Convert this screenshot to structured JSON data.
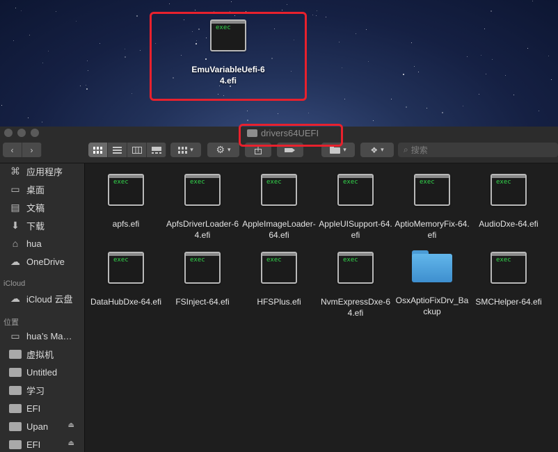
{
  "desktop": {
    "file": {
      "icon": "exec-file-icon",
      "icon_text": "exec",
      "label_line1": "EmuVariableUefi-6",
      "label_line2": "4.efi"
    }
  },
  "window": {
    "title": "drivers64UEFI",
    "toolbar": {
      "back": "‹",
      "forward": "›",
      "search_placeholder": "搜索"
    }
  },
  "sidebar": {
    "favorites": [
      {
        "label": "应用程序",
        "icon": "applications-icon"
      },
      {
        "label": "桌面",
        "icon": "desktop-icon"
      },
      {
        "label": "文稿",
        "icon": "documents-icon"
      },
      {
        "label": "下载",
        "icon": "downloads-icon"
      },
      {
        "label": "hua",
        "icon": "home-icon"
      },
      {
        "label": "OneDrive",
        "icon": "cloud-icon"
      }
    ],
    "icloud_header": "iCloud",
    "icloud": [
      {
        "label": "iCloud 云盘",
        "icon": "icloud-icon"
      }
    ],
    "locations_header": "位置",
    "locations": [
      {
        "label": "hua’s Ma…",
        "icon": "laptop-icon"
      },
      {
        "label": "虚拟机",
        "icon": "folder-icon"
      },
      {
        "label": "Untitled",
        "icon": "folder-icon"
      },
      {
        "label": "学习",
        "icon": "folder-icon"
      },
      {
        "label": "EFI",
        "icon": "folder-icon"
      },
      {
        "label": "Upan",
        "icon": "folder-icon",
        "eject": "⏏"
      },
      {
        "label": "EFI",
        "icon": "folder-icon",
        "eject": "⏏"
      }
    ]
  },
  "files": [
    {
      "name": "apfs.efi",
      "kind": "exec",
      "icon_text": "exec"
    },
    {
      "name": "ApfsDriverLoader-64.efi",
      "kind": "exec",
      "icon_text": "exec"
    },
    {
      "name": "AppleImageLoader-64.efi",
      "kind": "exec",
      "icon_text": "exec"
    },
    {
      "name": "AppleUISupport-64.efi",
      "kind": "exec",
      "icon_text": "exec"
    },
    {
      "name": "AptioMemoryFix-64.efi",
      "kind": "exec",
      "icon_text": "exec"
    },
    {
      "name": "AudioDxe-64.efi",
      "kind": "exec",
      "icon_text": "exec"
    },
    {
      "name": "DataHubDxe-64.efi",
      "kind": "exec",
      "icon_text": "exec"
    },
    {
      "name": "FSInject-64.efi",
      "kind": "exec",
      "icon_text": "exec"
    },
    {
      "name": "HFSPlus.efi",
      "kind": "exec",
      "icon_text": "exec"
    },
    {
      "name": "NvmExpressDxe-64.efi",
      "kind": "exec",
      "icon_text": "exec"
    },
    {
      "name": "OsxAptioFixDrv_Backup",
      "kind": "folder"
    },
    {
      "name": "SMCHelper-64.efi",
      "kind": "exec",
      "icon_text": "exec"
    }
  ],
  "colors": {
    "highlight": "#e8212d",
    "exec_text": "#32d74b",
    "folder": "#4fa3e0"
  }
}
